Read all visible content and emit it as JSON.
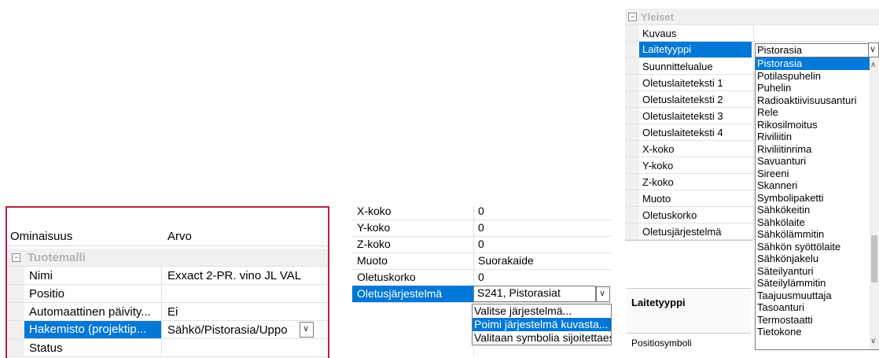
{
  "panel1": {
    "header": {
      "property": "Ominaisuus",
      "value": "Arvo"
    },
    "category": "Tuotemalli",
    "rows": [
      {
        "name": "Nimi",
        "value": "Exxact 2-PR. vino JL VAL"
      },
      {
        "name": "Positio",
        "value": ""
      },
      {
        "name": "Automaattinen päivity...",
        "value": "Ei"
      },
      {
        "name": "Hakemisto (projektip...",
        "value": "Sähkö/Pistorasia/Uppo"
      },
      {
        "name": "Status",
        "value": ""
      }
    ],
    "accent_color": "#b0243c"
  },
  "panel2": {
    "rows": [
      {
        "name": "X-koko",
        "value": "0"
      },
      {
        "name": "Y-koko",
        "value": "0"
      },
      {
        "name": "Z-koko",
        "value": "0"
      },
      {
        "name": "Muoto",
        "value": "Suorakaide"
      },
      {
        "name": "Oletuskorko",
        "value": "0"
      },
      {
        "name": "Oletusjärjestelmä",
        "value": "S241, Pistorasiat"
      }
    ],
    "dropdown_options": [
      "Valitse järjestelmä...",
      "Poimi järjestelmä kuvasta...",
      "Valitaan symbolia sijoitettaessa"
    ],
    "selected_option": "Poimi järjestelmä kuvasta..."
  },
  "panel3": {
    "category": "Yleiset",
    "rows": [
      {
        "name": "Kuvaus"
      },
      {
        "name": "Laitetyyppi",
        "value": "Pistorasia"
      },
      {
        "name": "Suunnittelualue"
      },
      {
        "name": "Oletuslaiteteksti 1"
      },
      {
        "name": "Oletuslaiteteksti 2"
      },
      {
        "name": "Oletuslaiteteksti 3"
      },
      {
        "name": "Oletuslaiteteksti 4"
      },
      {
        "name": "X-koko"
      },
      {
        "name": "Y-koko"
      },
      {
        "name": "Z-koko"
      },
      {
        "name": "Muoto"
      },
      {
        "name": "Oletuskorko"
      },
      {
        "name": "Oletusjärjestelmä"
      }
    ],
    "description_title": "Laitetyyppi",
    "bottom_row": "Positiosymboli",
    "options": [
      "Pistorasia",
      "Potilaspuhelin",
      "Puhelin",
      "Radioaktiivisuusanturi",
      "Rele",
      "Rikosilmoitus",
      "Riviliitin",
      "Riviliitinrima",
      "Savuanturi",
      "Sireeni",
      "Skanneri",
      "Symbolipaketti",
      "Sähkökeitin",
      "Sähkölaite",
      "Sähkölämmitin",
      "Sähkön syöttölaite",
      "Sähkönjakelu",
      "Säteilyanturi",
      "Säteilylämmitin",
      "Taajuusmuuttaja",
      "Tasoanturi",
      "Termostaatti",
      "Tietokone"
    ],
    "selected_option": "Pistorasia"
  },
  "selection_color": "#0078d7"
}
